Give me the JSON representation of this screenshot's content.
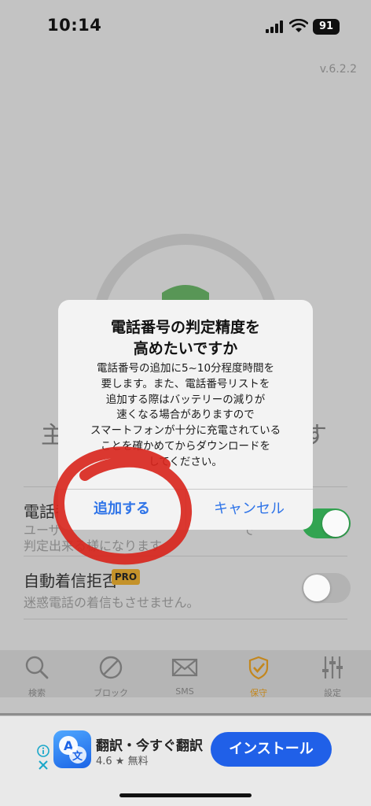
{
  "status_bar": {
    "time": "10:14",
    "battery": "91"
  },
  "version": "v.6.2.2",
  "main": {
    "title_left": "主",
    "title_right": "す",
    "settings": [
      {
        "label": "電話番",
        "desc_line1": "ユーザ",
        "desc_line1_right": "で",
        "desc_line2": "判定出来る様になります"
      },
      {
        "label": "自動着信拒否",
        "badge": "PRO",
        "desc": "迷惑電話の着信もさせません。"
      }
    ]
  },
  "dialog": {
    "title": "電話番号の判定精度を\n高めたいですか",
    "message": "電話番号の追加に5~10分程度時間を\n要します。また、電話番号リストを\n追加する際はバッテリーの減りが\n速くなる場合がありますので\nスマートフォンが十分に充電されている\nことを確かめてからダウンロードを\nしてください。",
    "confirm_label": "追加する",
    "cancel_label": "キャンセル"
  },
  "tabbar": {
    "tabs": [
      {
        "label": "検索",
        "icon": "search-icon"
      },
      {
        "label": "ブロック",
        "icon": "block-icon"
      },
      {
        "label": "SMS",
        "icon": "envelope-icon"
      },
      {
        "label": "保守",
        "icon": "shield-check-icon",
        "active": true
      },
      {
        "label": "設定",
        "icon": "sliders-icon"
      }
    ]
  },
  "ad": {
    "app_name": "翻訳・今すぐ翻訳",
    "rating": "4.6 ★ 無料",
    "install_label": "インストール",
    "info_icon": "info-icon",
    "close_icon": "close-icon"
  },
  "colors": {
    "accent_blue": "#2f74e8",
    "install_blue": "#2060e8",
    "toggle_on": "#34a853",
    "pro_badge": "#c8952b",
    "active_tab": "#c78a1f",
    "annotation_red": "#d8231b"
  }
}
